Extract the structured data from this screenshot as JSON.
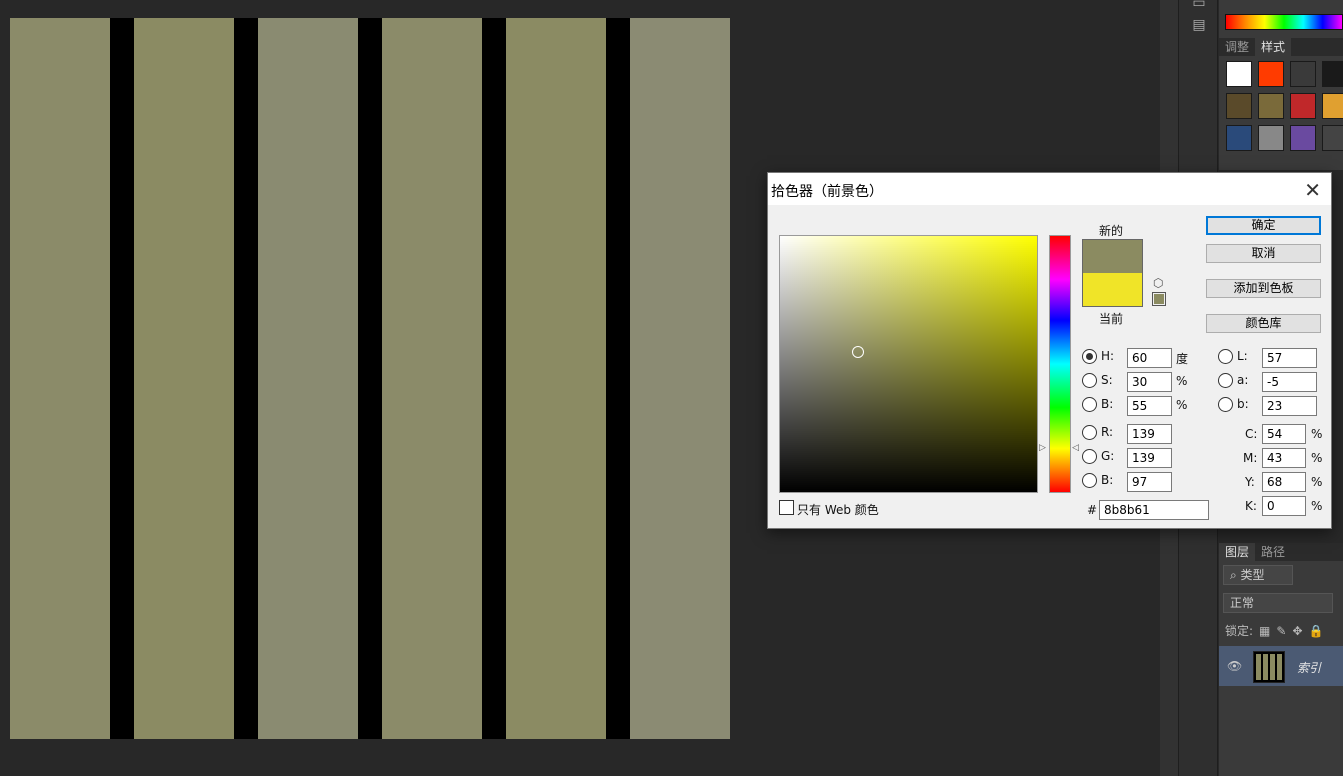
{
  "canvas": {
    "background": "#000000",
    "stripe_colors": [
      "#8b8b69",
      "#8b8b63",
      "#8a8b71",
      "#8b8b69",
      "#8b8b63",
      "#8b8b73"
    ]
  },
  "right_panel": {
    "tabs_top": [
      "调整",
      "样式"
    ],
    "tabs_bottom": [
      "图层",
      "路径"
    ],
    "filter_label": "类型",
    "blend_mode": "正常",
    "lock_label": "锁定:",
    "layer_name": "索引",
    "style_swatches": [
      "#ffffff",
      "#ff3b00",
      "#3a3a3a",
      "#1a1a1a",
      "#5a4a2a",
      "#7a6a3a",
      "#c0282a",
      "#e0a030",
      "#2a4a7a",
      "#888888",
      "#6a4aa0",
      "#444444"
    ]
  },
  "dialog": {
    "title": "拾色器（前景色）",
    "new_label": "新的",
    "current_label": "当前",
    "new_color": "#8b8b61",
    "current_color": "#f0e428",
    "buttons": {
      "ok": "确定",
      "cancel": "取消",
      "add_swatch": "添加到色板",
      "libraries": "颜色库"
    },
    "hsb": {
      "h_label": "H:",
      "h": "60",
      "h_unit": "度",
      "s_label": "S:",
      "s": "30",
      "s_unit": "%",
      "b_label": "B:",
      "b": "55",
      "b_unit": "%"
    },
    "rgb": {
      "r_label": "R:",
      "r": "139",
      "g_label": "G:",
      "g": "139",
      "b_label": "B:",
      "b": "97"
    },
    "lab": {
      "l_label": "L:",
      "l": "57",
      "a_label": "a:",
      "a": "-5",
      "b_label": "b:",
      "b": "23"
    },
    "cmyk": {
      "c_label": "C:",
      "c": "54",
      "m_label": "M:",
      "m": "43",
      "y_label": "Y:",
      "y": "68",
      "k_label": "K:",
      "k": "0",
      "unit": "%"
    },
    "hex_label": "#",
    "hex": "8b8b61",
    "web_only_label": "只有 Web 颜色"
  }
}
